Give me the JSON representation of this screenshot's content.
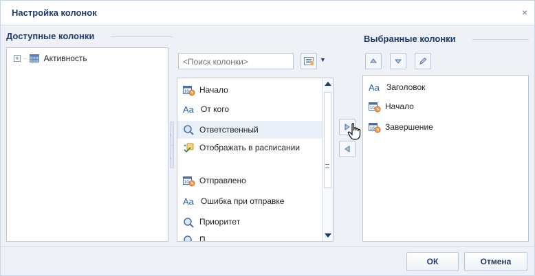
{
  "dialog": {
    "title": "Настройка колонок",
    "close_glyph": "×"
  },
  "available": {
    "title": "Доступные колонки",
    "tree": [
      {
        "label": "Активность",
        "expander": "+",
        "icon": "table-icon"
      }
    ]
  },
  "search": {
    "placeholder": "<Поиск колонки>",
    "icon": "column-view-icon"
  },
  "columns_list": [
    {
      "label": "Начало",
      "icon": "calendar-clock-icon"
    },
    {
      "label": "От кого",
      "icon": "text-aa-icon",
      "glyph": "Aa"
    },
    {
      "label": "Ответственный",
      "icon": "lookup-icon",
      "highlighted": true
    },
    {
      "label": "Отображать в расписании",
      "icon": "flag-check-icon"
    },
    {
      "label": "Отправлено",
      "icon": "calendar-clock-icon"
    },
    {
      "label": "Ошибка при отправке",
      "icon": "text-aa-icon",
      "glyph": "Aa"
    },
    {
      "label": "Приоритет",
      "icon": "lookup-icon"
    },
    {
      "label": "П...",
      "icon": "lookup-icon"
    }
  ],
  "selected": {
    "title": "Выбранные колонки",
    "items": [
      {
        "label": "Заголовок",
        "icon": "text-aa-icon",
        "glyph": "Aa"
      },
      {
        "label": "Начало",
        "icon": "calendar-clock-icon"
      },
      {
        "label": "Завершение",
        "icon": "calendar-clock-icon"
      }
    ]
  },
  "buttons": {
    "ok": "ОК",
    "cancel": "Отмена"
  },
  "colors": {
    "title_blue": "#1f3a6a",
    "panel_border": "#b8c6db",
    "dialog_bg": "#eef2f7",
    "highlight": "#eaf0f7"
  }
}
